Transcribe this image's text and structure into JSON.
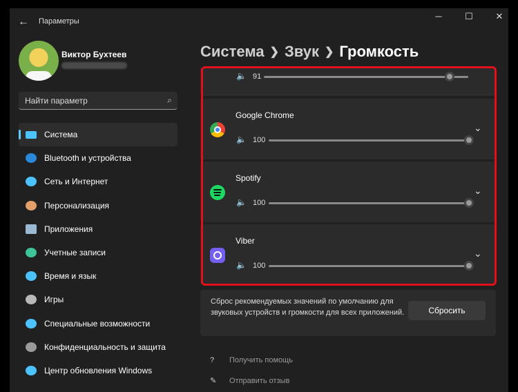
{
  "window": {
    "title": "Параметры"
  },
  "user": {
    "name": "Виктор Бухтеев"
  },
  "search": {
    "placeholder": "Найти параметр"
  },
  "nav": [
    {
      "label": "Система",
      "icon": "monitor-icon",
      "color": "#4cc2ff",
      "active": true
    },
    {
      "label": "Bluetooth и устройства",
      "icon": "bluetooth-icon",
      "color": "#2b88d8"
    },
    {
      "label": "Сеть и Интернет",
      "icon": "wifi-icon",
      "color": "#4cc2ff"
    },
    {
      "label": "Персонализация",
      "icon": "brush-icon",
      "color": "#e3a06a"
    },
    {
      "label": "Приложения",
      "icon": "apps-icon",
      "color": "#9bb8d3"
    },
    {
      "label": "Учетные записи",
      "icon": "account-icon",
      "color": "#3fc49a"
    },
    {
      "label": "Время и язык",
      "icon": "globe-clock-icon",
      "color": "#4cc2ff"
    },
    {
      "label": "Игры",
      "icon": "gamepad-icon",
      "color": "#b8b8b8"
    },
    {
      "label": "Специальные возможности",
      "icon": "accessibility-icon",
      "color": "#4cc2ff"
    },
    {
      "label": "Конфиденциальность и защита",
      "icon": "shield-icon",
      "color": "#9a9a9a"
    },
    {
      "label": "Центр обновления Windows",
      "icon": "update-icon",
      "color": "#4cc2ff"
    }
  ],
  "breadcrumb": {
    "part1": "Система",
    "part2": "Звук",
    "current": "Громкость"
  },
  "apps": [
    {
      "name": "",
      "volume": 91,
      "icon": ""
    },
    {
      "name": "Google Chrome",
      "volume": 100,
      "icon": "chrome-icon"
    },
    {
      "name": "Spotify",
      "volume": 100,
      "icon": "spotify-icon"
    },
    {
      "name": "Viber",
      "volume": 100,
      "icon": "viber-icon"
    }
  ],
  "reset": {
    "text": "Сброс рекомендуемых значений по умолчанию для звуковых устройств и громкости для всех приложений.",
    "button": "Сбросить"
  },
  "help": {
    "get_help": "Получить помощь",
    "feedback": "Отправить отзыв"
  },
  "colors": {
    "accent": "#60cdff",
    "highlight": "#e3101c"
  }
}
